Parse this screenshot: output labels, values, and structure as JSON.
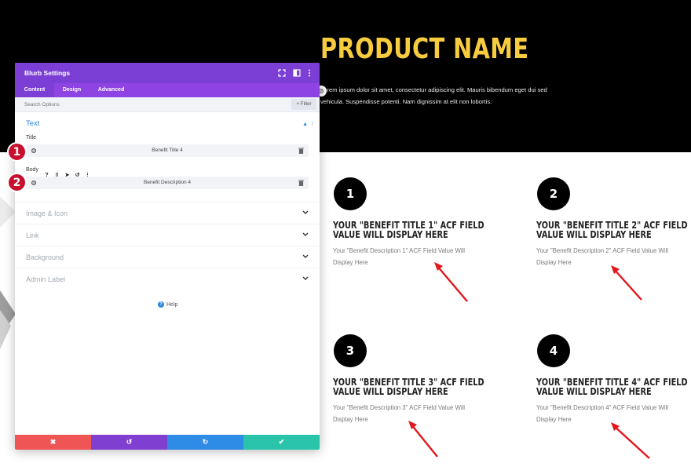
{
  "hero": {
    "product_name": "PRODUCT NAME",
    "text": "Lorem ipsum dolor sit amet, consectetur adipiscing elit. Mauris bibendum eget dui sed vehicula. Suspendisse potenti. Nam dignissim at elit non lobortis."
  },
  "benefits": [
    {
      "number": "1",
      "title_line1": "YOUR \"BENEFIT TITLE 1\" ACF FIELD",
      "title_line2": "VALUE WILL DISPLAY HERE",
      "desc": "Your \"Benefit Description 1\" ACF Field Value Will Display Here"
    },
    {
      "number": "2",
      "title_line1": "YOUR \"BENEFIT TITLE 2\" ACF FIELD",
      "title_line2": "VALUE WILL DISPLAY HERE",
      "desc": "Your \"Benefit Description 2\" ACF Field Value Will Display Here"
    },
    {
      "number": "3",
      "title_line1": "YOUR \"BENEFIT TITLE 3\" ACF FIELD",
      "title_line2": "VALUE WILL DISPLAY HERE",
      "desc": "Your \"Benefit Description 3\" ACF Field Value Will Display Here"
    },
    {
      "number": "4",
      "title_line1": "YOUR \"BENEFIT TITLE 4\" ACF FIELD",
      "title_line2": "VALUE WILL DISPLAY HERE",
      "desc": "Your \"Benefit Description 4\" ACF Field Value Will Display Here"
    }
  ],
  "panel": {
    "title": "Blurb Settings",
    "tabs": [
      "Content",
      "Design",
      "Advanced"
    ],
    "active_tab": "Content",
    "search_placeholder": "Search Options",
    "filter_label": "+ Filter",
    "section_title": "Text",
    "title_label": "Title",
    "title_value": "Benefit Title 4",
    "body_label": "Body",
    "body_value": "Benefit Description 4",
    "toggles": [
      "Image & Icon",
      "Link",
      "Background",
      "Admin Label"
    ],
    "help_label": "Help",
    "help_icon_glyph": "?",
    "footer_glyphs": {
      "cancel": "✖",
      "undo": "↺",
      "redo": "↻",
      "save": "✔"
    },
    "icons": {
      "head": [
        "expand-icon",
        "columns-icon",
        "more-icon"
      ],
      "body_toolbar": [
        "help-icon",
        "mobile-icon",
        "pointer-icon",
        "undo-icon",
        "more-icon"
      ],
      "body_toolbar_glyphs": [
        "?",
        "▯",
        "➤",
        "↺",
        "⋮"
      ],
      "section_glyphs": "▲ ⋮"
    }
  },
  "markers": [
    "1",
    "2"
  ],
  "colors": {
    "accent_yellow": "#f7cc3f",
    "panel_purple": "#7b3fd6",
    "tab_purple": "#8e44e3",
    "link_blue": "#2b87da",
    "arrow_red": "#e3171c",
    "marker_red": "#c8102e",
    "footer_red": "#ef5555",
    "footer_purple": "#7f3fd0",
    "footer_blue": "#2e8be6",
    "footer_green": "#29c4a9"
  }
}
